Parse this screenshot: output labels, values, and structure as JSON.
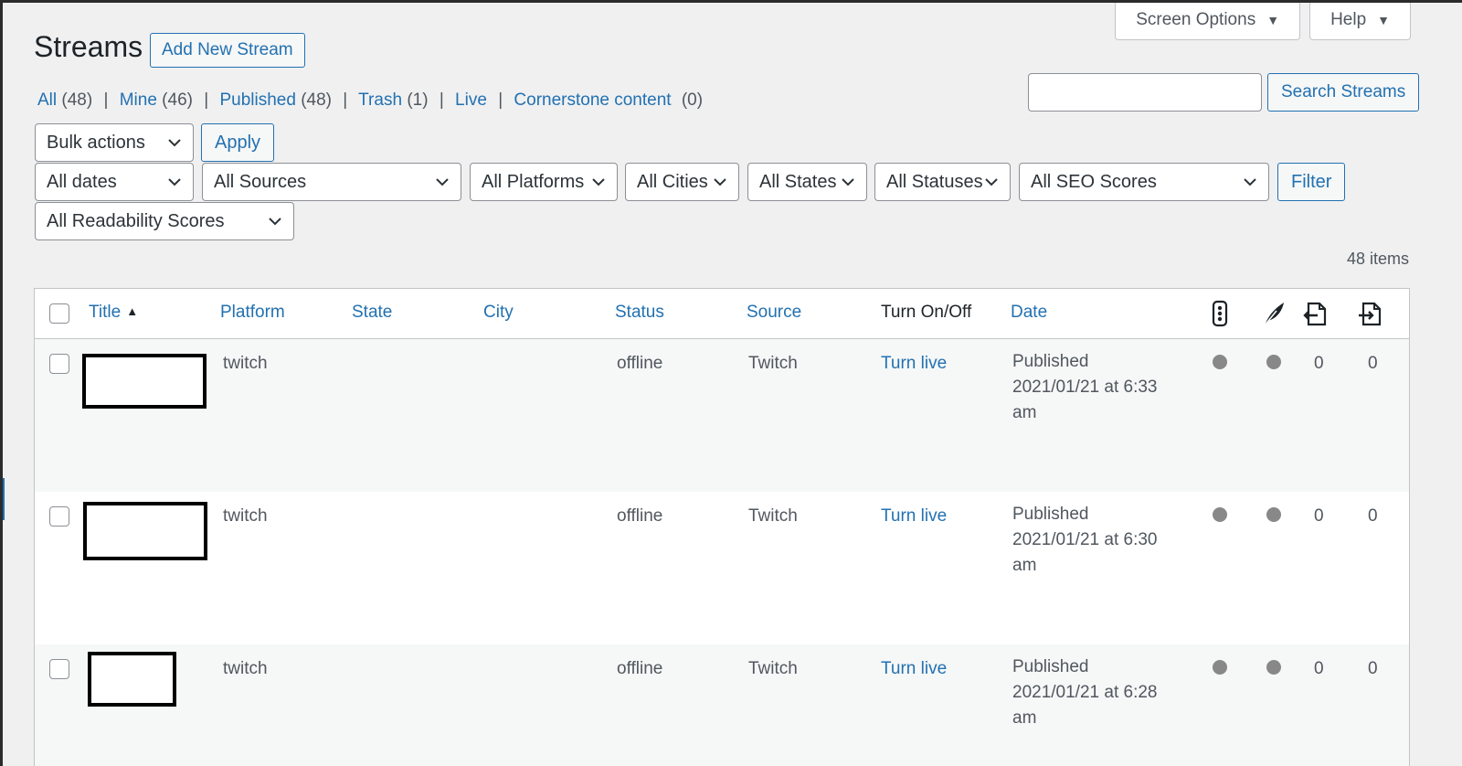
{
  "header": {
    "title": "Streams",
    "add_new_label": "Add New Stream",
    "screen_options_label": "Screen Options",
    "help_label": "Help"
  },
  "views": [
    {
      "label": "All",
      "count": "(48)"
    },
    {
      "label": "Mine",
      "count": "(46)"
    },
    {
      "label": "Published",
      "count": "(48)"
    },
    {
      "label": "Trash",
      "count": "(1)"
    },
    {
      "label": "Live",
      "count": ""
    },
    {
      "label": "Cornerstone content",
      "count": "(0)"
    }
  ],
  "search": {
    "value": "",
    "button_label": "Search Streams"
  },
  "bulk": {
    "select_label": "Bulk actions",
    "apply_label": "Apply"
  },
  "filters": {
    "dates": "All dates",
    "sources": "All Sources",
    "platforms": "All Platforms",
    "cities": "All Cities",
    "states": "All States",
    "statuses": "All Statuses",
    "seo_scores": "All SEO Scores",
    "readability_scores": "All Readability Scores",
    "filter_button_label": "Filter"
  },
  "items_count": "48 items",
  "table": {
    "columns": {
      "title": "Title",
      "platform": "Platform",
      "state": "State",
      "city": "City",
      "status": "Status",
      "source": "Source",
      "turn": "Turn On/Off",
      "date": "Date"
    },
    "header_icons": [
      "seo-score-icon",
      "readability-feather-icon",
      "internal-links-icon",
      "incoming-links-icon"
    ],
    "rows": [
      {
        "platform": "twitch",
        "state": "",
        "city": "",
        "status": "offline",
        "source": "Twitch",
        "action": "Turn live",
        "date_status": "Published",
        "date_value": "2021/01/21 at 6:33 am",
        "links_out": "0",
        "links_in": "0"
      },
      {
        "platform": "twitch",
        "state": "",
        "city": "",
        "status": "offline",
        "source": "Twitch",
        "action": "Turn live",
        "date_status": "Published",
        "date_value": "2021/01/21 at 6:30 am",
        "links_out": "0",
        "links_in": "0"
      },
      {
        "platform": "twitch",
        "state": "",
        "city": "",
        "status": "offline",
        "source": "Twitch",
        "action": "Turn live",
        "date_status": "Published",
        "date_value": "2021/01/21 at 6:28 am",
        "links_out": "0",
        "links_in": "0"
      }
    ]
  },
  "colors": {
    "accent": "#2271b1",
    "background": "#f0f0f1",
    "score_dot": "#888888"
  }
}
